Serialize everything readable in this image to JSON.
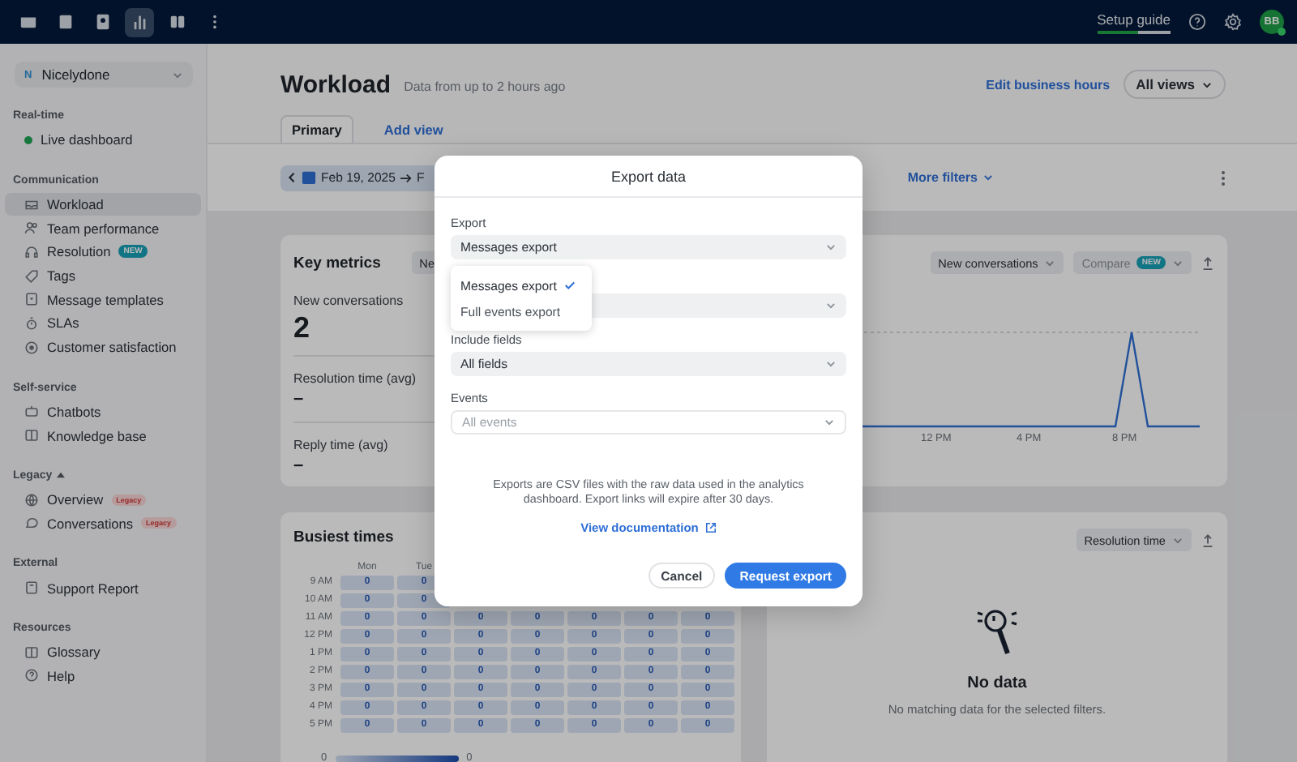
{
  "topbar": {
    "apps": [
      {
        "selected": false
      },
      {
        "selected": false
      },
      {
        "selected": false
      },
      {
        "selected": true
      },
      {
        "selected": false
      },
      {
        "selected": false
      }
    ],
    "setup_guide": {
      "label": "Setup guide",
      "level": 0.55
    },
    "avatar": "BB"
  },
  "sidebar": {
    "workspace": {
      "initial": "N",
      "name": "Nicelydone"
    },
    "sections": [
      {
        "title": "Real-time",
        "items": [
          {
            "label": "Live dashboard",
            "kind": "plain",
            "selected": false
          }
        ]
      },
      {
        "title": "Communication",
        "items": [
          {
            "label": "Workload",
            "kind": "plain",
            "selected": true
          },
          {
            "label": "Team performance",
            "kind": "plain",
            "selected": false
          },
          {
            "label": "Resolution",
            "kind": "new",
            "badge": "NEW",
            "selected": false
          },
          {
            "label": "Tags",
            "kind": "plain",
            "selected": false
          },
          {
            "label": "Message templates",
            "kind": "plain",
            "selected": false
          },
          {
            "label": "SLAs",
            "kind": "plain",
            "selected": false
          },
          {
            "label": "Customer satisfaction",
            "kind": "plain",
            "selected": false
          }
        ]
      },
      {
        "title": "Self-service",
        "items": [
          {
            "label": "Chatbots",
            "kind": "plain",
            "selected": false
          },
          {
            "label": "Knowledge base",
            "kind": "plain",
            "selected": false
          }
        ]
      },
      {
        "title": "Legacy",
        "expanded": true,
        "items": [
          {
            "label": "Overview",
            "kind": "legacy",
            "badge": "Legacy",
            "selected": false
          },
          {
            "label": "Conversations",
            "kind": "legacy",
            "badge": "Legacy",
            "selected": false
          }
        ]
      },
      {
        "title": "External",
        "items": [
          {
            "label": "Support Report",
            "kind": "plain",
            "selected": false
          }
        ]
      },
      {
        "title": "Resources",
        "items": [
          {
            "label": "Glossary",
            "kind": "plain",
            "selected": false
          },
          {
            "label": "Help",
            "kind": "plain",
            "selected": false
          }
        ]
      }
    ]
  },
  "header": {
    "title": "Workload",
    "subtitle": "Data from up to 2 hours ago",
    "link": "Edit business hours",
    "views_button": "All views",
    "tabs": [
      {
        "label": "Primary",
        "selected": true
      },
      {
        "label": "Add view",
        "selected": false
      }
    ]
  },
  "filters": {
    "date_start": "Feb 19, 2025",
    "date_end_partial": "F",
    "more_filters": "More filters"
  },
  "key_metrics": {
    "title": "Key metrics",
    "select_partial": "Ne",
    "metrics": [
      {
        "label": "New conversations",
        "value": "2"
      },
      {
        "label": "Resolution time (avg)",
        "value": "–"
      },
      {
        "label": "Reply time (avg)",
        "value": "–"
      }
    ]
  },
  "trend_chart": {
    "metric_select": "New conversations",
    "compare": "Compare",
    "compare_badge": "NEW",
    "x_labels": [
      "12 PM",
      "4 PM",
      "8 PM"
    ]
  },
  "busiest_times": {
    "title": "Busiest times",
    "columns": [
      "Mon",
      "Tue"
    ],
    "rows": [
      {
        "hour": "9 AM",
        "cells": [
          "0",
          "0"
        ]
      },
      {
        "hour": "10 AM",
        "cells": [
          "0",
          "0"
        ]
      },
      {
        "hour": "11 AM",
        "cells": [
          "0",
          "0",
          "0",
          "0",
          "0",
          "0",
          "0"
        ]
      },
      {
        "hour": "12 PM",
        "cells": [
          "0",
          "0",
          "0",
          "0",
          "0",
          "0",
          "0"
        ]
      },
      {
        "hour": "1 PM",
        "cells": [
          "0",
          "0",
          "0",
          "0",
          "0",
          "0",
          "0"
        ]
      },
      {
        "hour": "2 PM",
        "cells": [
          "0",
          "0",
          "0",
          "0",
          "0",
          "0",
          "0"
        ]
      },
      {
        "hour": "3 PM",
        "cells": [
          "0",
          "0",
          "0",
          "0",
          "0",
          "0",
          "0"
        ]
      },
      {
        "hour": "4 PM",
        "cells": [
          "0",
          "0",
          "0",
          "0",
          "0",
          "0",
          "0"
        ]
      },
      {
        "hour": "5 PM",
        "cells": [
          "0",
          "0",
          "0",
          "0",
          "0",
          "0",
          "0"
        ]
      }
    ],
    "legend_min": "0",
    "legend_max": "0"
  },
  "resolution_card": {
    "select": "Resolution time",
    "empty_title": "No data",
    "empty_text": "No matching data for the selected filters."
  },
  "modal": {
    "title": "Export data",
    "fields": [
      {
        "kind": "select",
        "label": "Export",
        "value": "Messages export"
      },
      {
        "kind": "select"
      },
      {
        "kind": "select",
        "label": "Include fields",
        "value": "All fields"
      },
      {
        "kind": "select",
        "label": "Events",
        "placeholder": "All events"
      }
    ],
    "menu": [
      {
        "label": "Messages export",
        "selected": true
      },
      {
        "label": "Full events export",
        "selected": false
      }
    ],
    "info": "Exports are CSV files with the raw data used in the analytics dashboard. Export links will expire after 30 days.",
    "doc_link": "View documentation",
    "cancel": "Cancel",
    "submit": "Request export"
  }
}
